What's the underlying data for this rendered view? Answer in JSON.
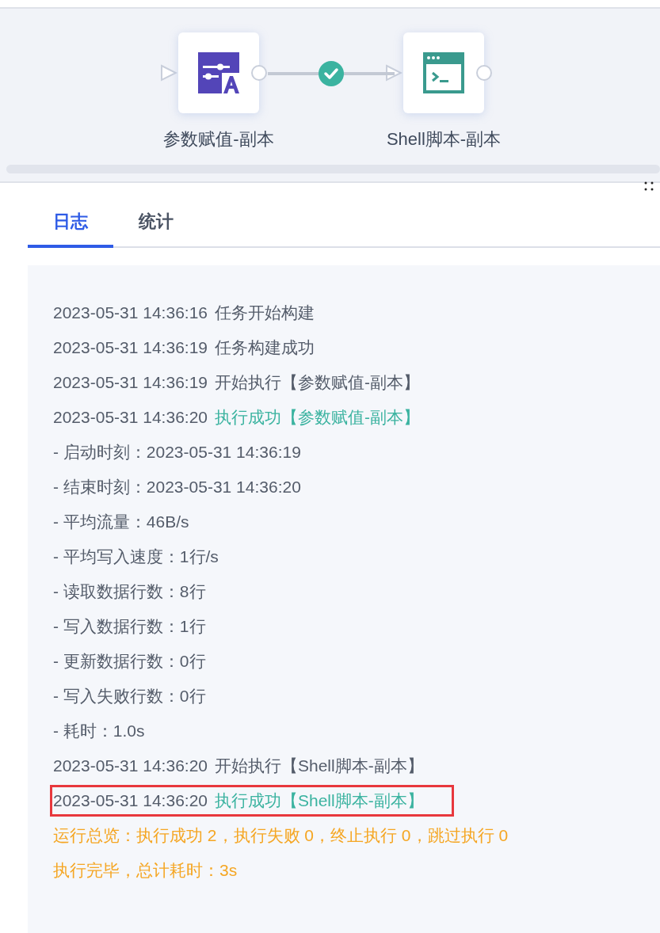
{
  "canvas": {
    "nodes": [
      {
        "label": "参数赋值-副本",
        "kind": "assign"
      },
      {
        "label": "Shell脚本-副本",
        "kind": "shell"
      }
    ],
    "edges": [
      {
        "succeeded": true
      }
    ]
  },
  "tabs": [
    {
      "label": "日志",
      "selected": true
    },
    {
      "label": "统计",
      "selected": false
    }
  ],
  "log": [
    {
      "kind": "plain",
      "time": "2023-05-31 14:36:16",
      "text": "任务开始构建",
      "highlighted": false
    },
    {
      "kind": "plain",
      "time": "2023-05-31 14:36:19",
      "text": "任务构建成功",
      "highlighted": false
    },
    {
      "kind": "plain",
      "time": "2023-05-31 14:36:19",
      "text": "开始执行【参数赋值-副本】",
      "highlighted": false
    },
    {
      "kind": "success",
      "time": "2023-05-31 14:36:20",
      "text": "执行成功【参数赋值-副本】",
      "highlighted": false
    },
    {
      "kind": "detail",
      "text": "- 启动时刻：2023-05-31 14:36:19",
      "highlighted": false
    },
    {
      "kind": "detail",
      "text": "- 结束时刻：2023-05-31 14:36:20",
      "highlighted": false
    },
    {
      "kind": "detail",
      "text": "- 平均流量：46B/s",
      "highlighted": false
    },
    {
      "kind": "detail",
      "text": "- 平均写入速度：1行/s",
      "highlighted": false
    },
    {
      "kind": "detail",
      "text": "- 读取数据行数：8行",
      "highlighted": false
    },
    {
      "kind": "detail",
      "text": "- 写入数据行数：1行",
      "highlighted": false
    },
    {
      "kind": "detail",
      "text": "- 更新数据行数：0行",
      "highlighted": false
    },
    {
      "kind": "detail",
      "text": "- 写入失败行数：0行",
      "highlighted": false
    },
    {
      "kind": "detail",
      "text": "- 耗时：1.0s",
      "highlighted": false
    },
    {
      "kind": "plain",
      "time": "2023-05-31 14:36:20",
      "text": "开始执行【Shell脚本-副本】",
      "highlighted": false
    },
    {
      "kind": "success",
      "time": "2023-05-31 14:36:20",
      "text": "执行成功【Shell脚本-副本】",
      "highlighted": true
    },
    {
      "kind": "summary",
      "text": "运行总览：执行成功 2，执行失败 0，终止执行 0，跳过执行 0",
      "highlighted": false
    },
    {
      "kind": "summary",
      "text": "执行完毕，总计耗时：3s",
      "highlighted": false
    }
  ]
}
